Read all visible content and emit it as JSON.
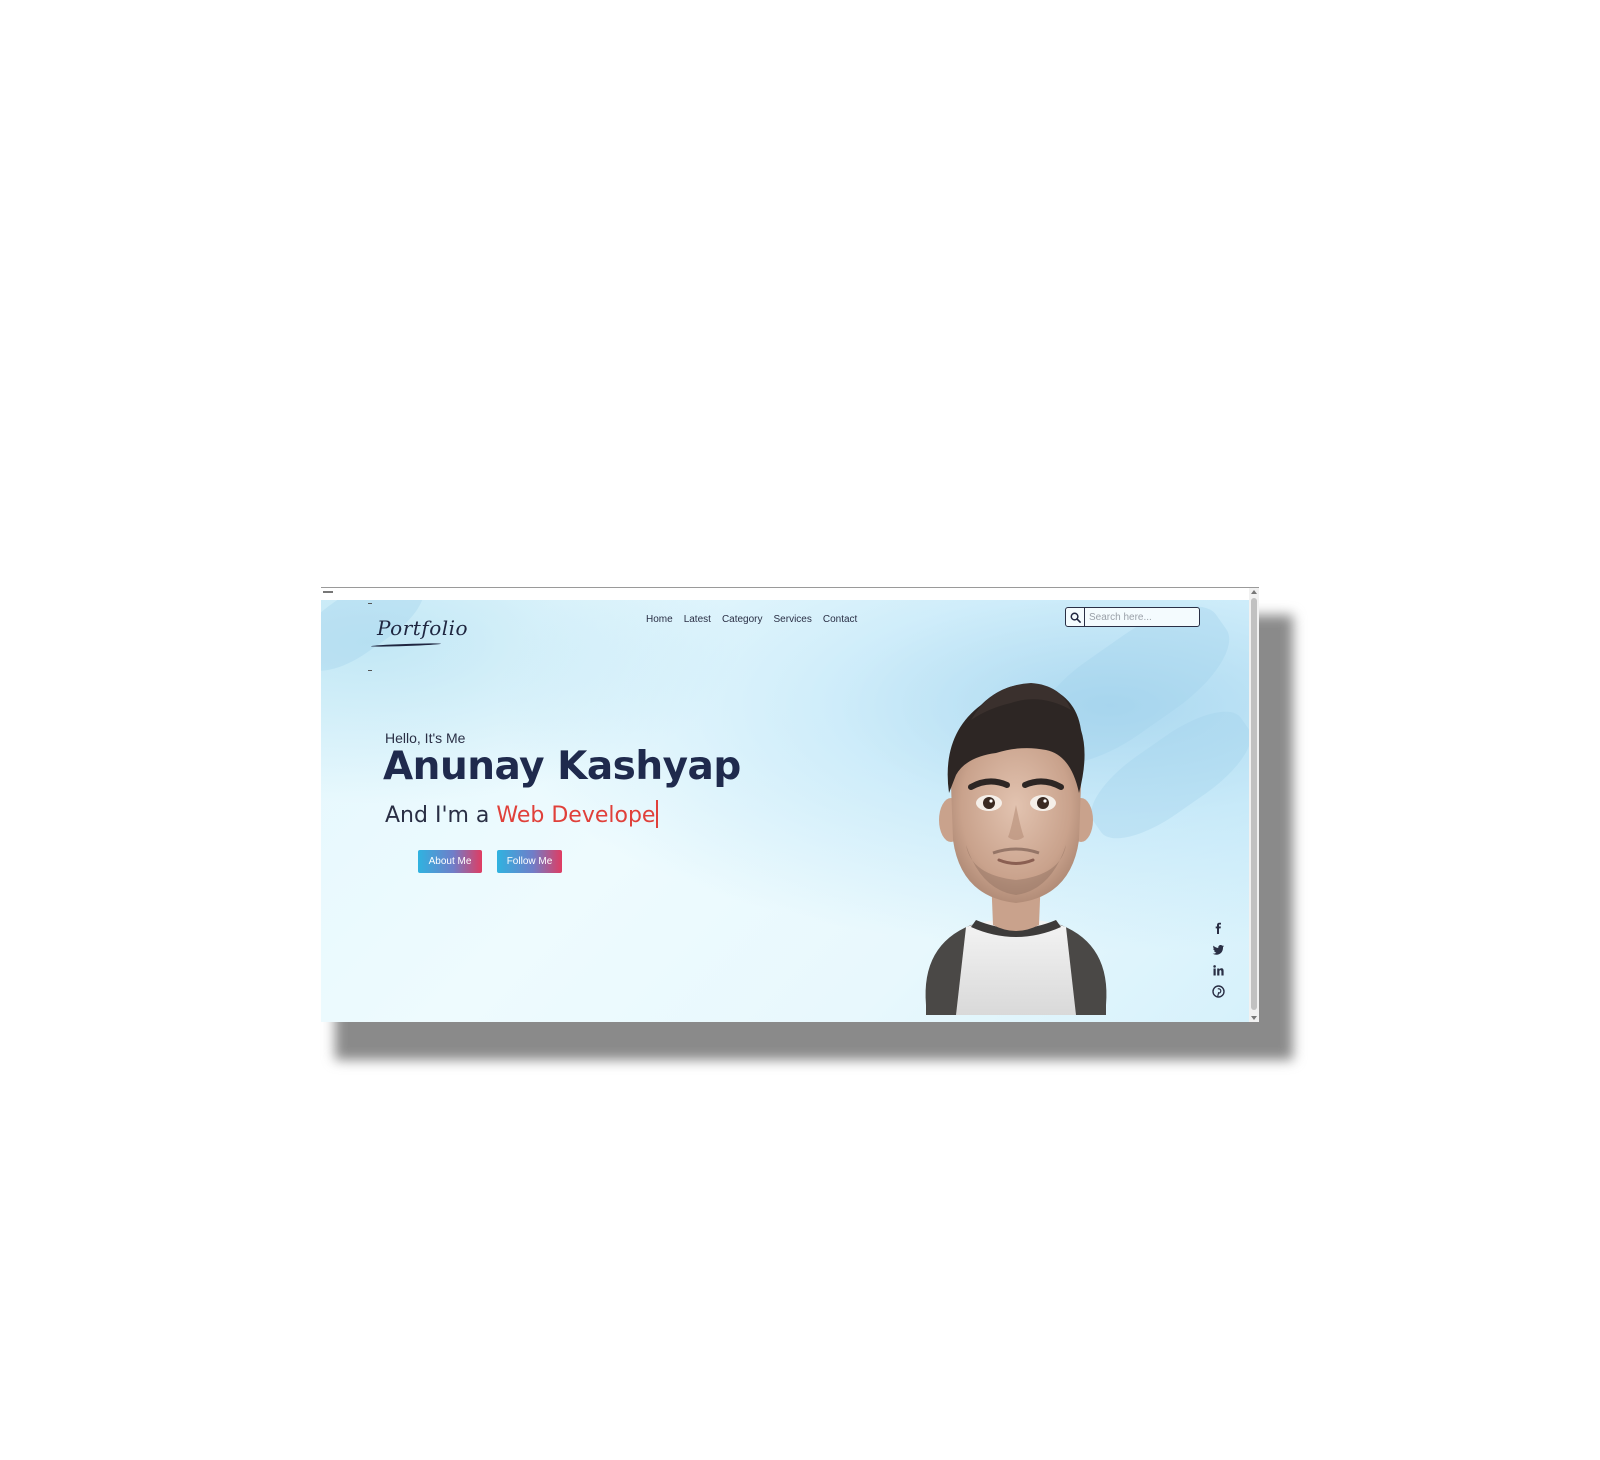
{
  "site": {
    "logo_text": "Portfolio"
  },
  "nav": {
    "items": [
      {
        "label": "Home"
      },
      {
        "label": "Latest"
      },
      {
        "label": "Category"
      },
      {
        "label": "Services"
      },
      {
        "label": "Contact"
      }
    ]
  },
  "search": {
    "placeholder": "Search here...",
    "icon": "search-icon"
  },
  "hero": {
    "greeting": "Hello, It's Me",
    "name": "Anunay Kashyap",
    "role_prefix": "And I'm a ",
    "role_typed": "Web Develope",
    "buttons": {
      "about_label": "About Me",
      "follow_label": "Follow Me"
    }
  },
  "social": {
    "icons": [
      "facebook-icon",
      "twitter-icon",
      "linkedin-icon",
      "pinterest-icon"
    ]
  },
  "colors": {
    "accent_red": "#e0403a",
    "heading_navy": "#1f2a4d",
    "button_gradient_start": "#2fb3e0",
    "button_gradient_end": "#e03c62",
    "background": "#e8f8fd"
  }
}
